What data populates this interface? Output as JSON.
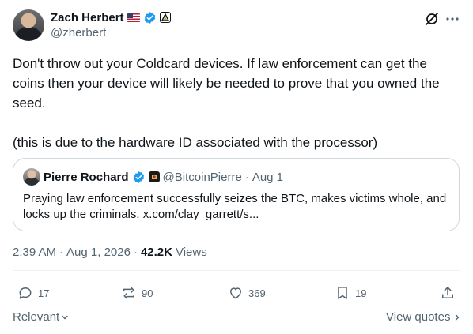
{
  "author": {
    "name": "Zach Herbert",
    "handle": "@zherbert",
    "flag_icon": "us-flag-icon",
    "verified_color": "#1d9bf0"
  },
  "tweet": {
    "text": "Don't throw out your Coldcard devices. If law enforcement can get the coins then your device will likely be needed to prove that you owned the seed.\n\n(this is due to the hardware ID associated with the processor)"
  },
  "quote": {
    "name": "Pierre Rochard",
    "handle": "@BitcoinPierre",
    "separator": "·",
    "date": "Aug 1",
    "text": "Praying law enforcement successfully seizes the BTC, makes victims whole, and locks up the criminals. x.com/clay_garrett/s..."
  },
  "meta": {
    "time": "2:39 AM",
    "separator1": "·",
    "date": "Aug 1, 2026",
    "separator2": "·",
    "views_count": "42.2K",
    "views_label": "Views"
  },
  "actions": {
    "replies": "17",
    "reposts": "90",
    "likes": "369",
    "bookmarks": "19"
  },
  "footer": {
    "sort_label": "Relevant",
    "view_quotes": "View quotes"
  },
  "colors": {
    "text": "#0f1419",
    "secondary": "#536471",
    "border": "#cfd9de",
    "accent": "#1d9bf0"
  }
}
